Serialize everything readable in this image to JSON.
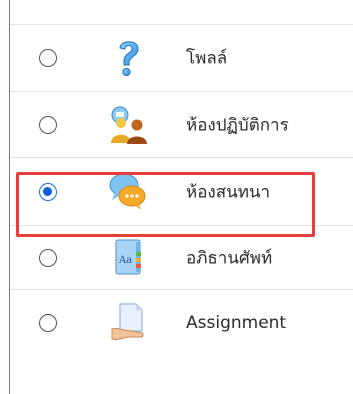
{
  "activity_list": {
    "items": [
      {
        "label": "โพลล์",
        "selected": false,
        "icon": "question-icon"
      },
      {
        "label": "ห้องปฏิบัติการ",
        "selected": false,
        "icon": "workshop-icon"
      },
      {
        "label": "ห้องสนทนา",
        "selected": true,
        "icon": "chat-icon"
      },
      {
        "label": "อภิธานศัพท์",
        "selected": false,
        "icon": "glossary-icon"
      },
      {
        "label": "Assignment",
        "selected": false,
        "icon": "assignment-icon"
      }
    ]
  },
  "colors": {
    "highlight_border": "#e53e3e",
    "radio_selected": "#0b5ed7",
    "frame_border": "#5b7fb5"
  }
}
